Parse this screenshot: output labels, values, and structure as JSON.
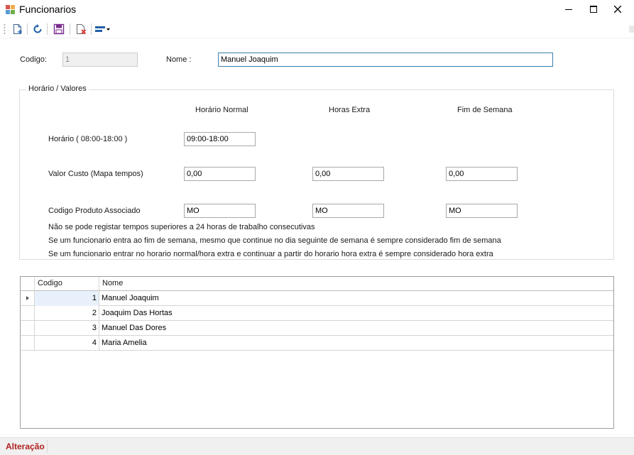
{
  "window": {
    "title": "Funcionarios",
    "minimize": "minimize",
    "maximize": "maximize",
    "close": "close"
  },
  "toolbar": {
    "items": [
      {
        "name": "new-document-icon"
      },
      {
        "name": "refresh-icon"
      },
      {
        "name": "save-icon"
      },
      {
        "name": "delete-icon"
      },
      {
        "name": "layout-dropdown-icon"
      }
    ]
  },
  "form": {
    "codigo_label": "Codigo:",
    "codigo_value": "1",
    "nome_label": "Nome :",
    "nome_value": "Manuel Joaquim"
  },
  "group": {
    "title": "Horário / Valores",
    "columns": [
      "Horário Normal",
      "Horas Extra",
      "Fim de Semana"
    ],
    "horario_label": "Horário ( 08:00-18:00 )",
    "horario_normal": "09:00-18:00",
    "valor_custo_label": "Valor Custo (Mapa tempos)",
    "valor_custo": [
      "0,00",
      "0,00",
      "0,00"
    ],
    "codigo_produto_label": "Codigo Produto Associado",
    "codigo_produto": [
      "MO",
      "MO",
      "MO"
    ],
    "notes": [
      "Não se pode registar tempos superiores a 24 horas de trabalho consecutivas",
      "Se um funcionario entra ao fim de semana, mesmo que continue no dia seguinte de semana é sempre considerado fim de semana",
      "Se um funcionario entrar no horario normal/hora extra e continuar a partir do horario hora extra é sempre considerado hora extra"
    ]
  },
  "grid": {
    "headers": [
      "Codigo",
      "Nome"
    ],
    "rows": [
      {
        "codigo": "1",
        "nome": "Manuel Joaquim",
        "current": true
      },
      {
        "codigo": "2",
        "nome": "Joaquim Das Hortas",
        "current": false
      },
      {
        "codigo": "3",
        "nome": "Manuel Das Dores",
        "current": false
      },
      {
        "codigo": "4",
        "nome": "Maria Amelia",
        "current": false
      }
    ]
  },
  "status": {
    "text": "Alteração"
  },
  "colors": {
    "status_text": "#b22222",
    "focus_border": "#3c7fb1",
    "current_row": "#e8f1fb"
  }
}
